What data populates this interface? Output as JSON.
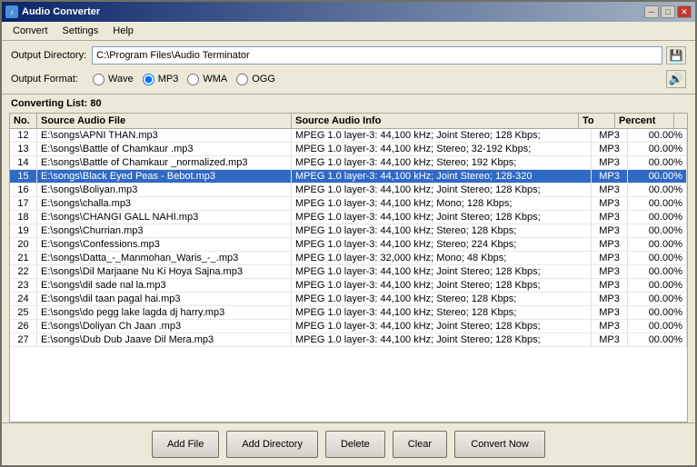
{
  "window": {
    "title": "Audio Converter",
    "icon": "♪"
  },
  "titlebar": {
    "minimize": "─",
    "maximize": "□",
    "close": "✕"
  },
  "menu": {
    "items": [
      "Convert",
      "Settings",
      "Help"
    ]
  },
  "toolbar": {
    "output_dir_label": "Output Directory:",
    "output_dir_value": "C:\\Program Files\\Audio Terminator",
    "output_format_label": "Output Format:",
    "formats": [
      {
        "id": "wave",
        "label": "Wave",
        "checked": false
      },
      {
        "id": "mp3",
        "label": "MP3",
        "checked": true
      },
      {
        "id": "wma",
        "label": "WMA",
        "checked": false
      },
      {
        "id": "ogg",
        "label": "OGG",
        "checked": false
      }
    ]
  },
  "table": {
    "converting_header": "Converting List: 80",
    "columns": [
      "No.",
      "Source Audio File",
      "Source Audio Info",
      "To",
      "Percent"
    ],
    "rows": [
      {
        "no": "12",
        "file": "E:\\songs\\APNI THAN.mp3",
        "info": "MPEG 1.0 layer-3: 44,100 kHz; Joint Stereo; 128 Kbps;",
        "to": "MP3",
        "pct": "00.00%",
        "selected": false
      },
      {
        "no": "13",
        "file": "E:\\songs\\Battle of Chamkaur .mp3",
        "info": "MPEG 1.0 layer-3: 44,100 kHz; Stereo; 32-192 Kbps;",
        "to": "MP3",
        "pct": "00.00%",
        "selected": false
      },
      {
        "no": "14",
        "file": "E:\\songs\\Battle of Chamkaur _normalized.mp3",
        "info": "MPEG 1.0 layer-3: 44,100 kHz; Stereo; 192 Kbps;",
        "to": "MP3",
        "pct": "00.00%",
        "selected": false
      },
      {
        "no": "15",
        "file": "E:\\songs\\Black Eyed Peas - Bebot.mp3",
        "info": "MPEG 1.0 layer-3: 44,100 kHz; Joint Stereo; 128-320",
        "to": "MP3",
        "pct": "00.00%",
        "selected": true
      },
      {
        "no": "16",
        "file": "E:\\songs\\Boliyan.mp3",
        "info": "MPEG 1.0 layer-3: 44,100 kHz; Joint Stereo; 128 Kbps;",
        "to": "MP3",
        "pct": "00.00%",
        "selected": false
      },
      {
        "no": "17",
        "file": "E:\\songs\\challa.mp3",
        "info": "MPEG 1.0 layer-3: 44,100 kHz; Mono; 128 Kbps;",
        "to": "MP3",
        "pct": "00.00%",
        "selected": false
      },
      {
        "no": "18",
        "file": "E:\\songs\\CHANGI GALL NAHI.mp3",
        "info": "MPEG 1.0 layer-3: 44,100 kHz; Joint Stereo; 128 Kbps;",
        "to": "MP3",
        "pct": "00.00%",
        "selected": false
      },
      {
        "no": "19",
        "file": "E:\\songs\\Churrian.mp3",
        "info": "MPEG 1.0 layer-3: 44,100 kHz; Stereo; 128 Kbps;",
        "to": "MP3",
        "pct": "00.00%",
        "selected": false
      },
      {
        "no": "20",
        "file": "E:\\songs\\Confessions.mp3",
        "info": "MPEG 1.0 layer-3: 44,100 kHz; Stereo; 224 Kbps;",
        "to": "MP3",
        "pct": "00.00%",
        "selected": false
      },
      {
        "no": "21",
        "file": "E:\\songs\\Datta_-_Manmohan_Waris_-_.mp3",
        "info": "MPEG 1.0 layer-3: 32,000 kHz; Mono; 48 Kbps;",
        "to": "MP3",
        "pct": "00.00%",
        "selected": false
      },
      {
        "no": "22",
        "file": "E:\\songs\\Dil Marjaane Nu Ki Hoya Sajna.mp3",
        "info": "MPEG 1.0 layer-3: 44,100 kHz; Joint Stereo; 128 Kbps;",
        "to": "MP3",
        "pct": "00.00%",
        "selected": false
      },
      {
        "no": "23",
        "file": "E:\\songs\\dil sade nal la.mp3",
        "info": "MPEG 1.0 layer-3: 44,100 kHz; Joint Stereo; 128 Kbps;",
        "to": "MP3",
        "pct": "00.00%",
        "selected": false
      },
      {
        "no": "24",
        "file": "E:\\songs\\dil taan pagal hai.mp3",
        "info": "MPEG 1.0 layer-3: 44,100 kHz; Stereo; 128 Kbps;",
        "to": "MP3",
        "pct": "00.00%",
        "selected": false
      },
      {
        "no": "25",
        "file": "E:\\songs\\do pegg lake lagda  dj harry.mp3",
        "info": "MPEG 1.0 layer-3: 44,100 kHz; Stereo; 128 Kbps;",
        "to": "MP3",
        "pct": "00.00%",
        "selected": false
      },
      {
        "no": "26",
        "file": "E:\\songs\\Doliyan Ch Jaan .mp3",
        "info": "MPEG 1.0 layer-3: 44,100 kHz; Joint Stereo; 128 Kbps;",
        "to": "MP3",
        "pct": "00.00%",
        "selected": false
      },
      {
        "no": "27",
        "file": "E:\\songs\\Dub Dub Jaave Dil Mera.mp3",
        "info": "MPEG 1.0 layer-3: 44,100 kHz; Joint Stereo; 128 Kbps;",
        "to": "MP3",
        "pct": "00.00%",
        "selected": false
      }
    ]
  },
  "actions": {
    "add_file": "Add File",
    "add_directory": "Add Directory",
    "delete": "Delete",
    "clear": "Clear",
    "convert_now": "Convert Now"
  }
}
